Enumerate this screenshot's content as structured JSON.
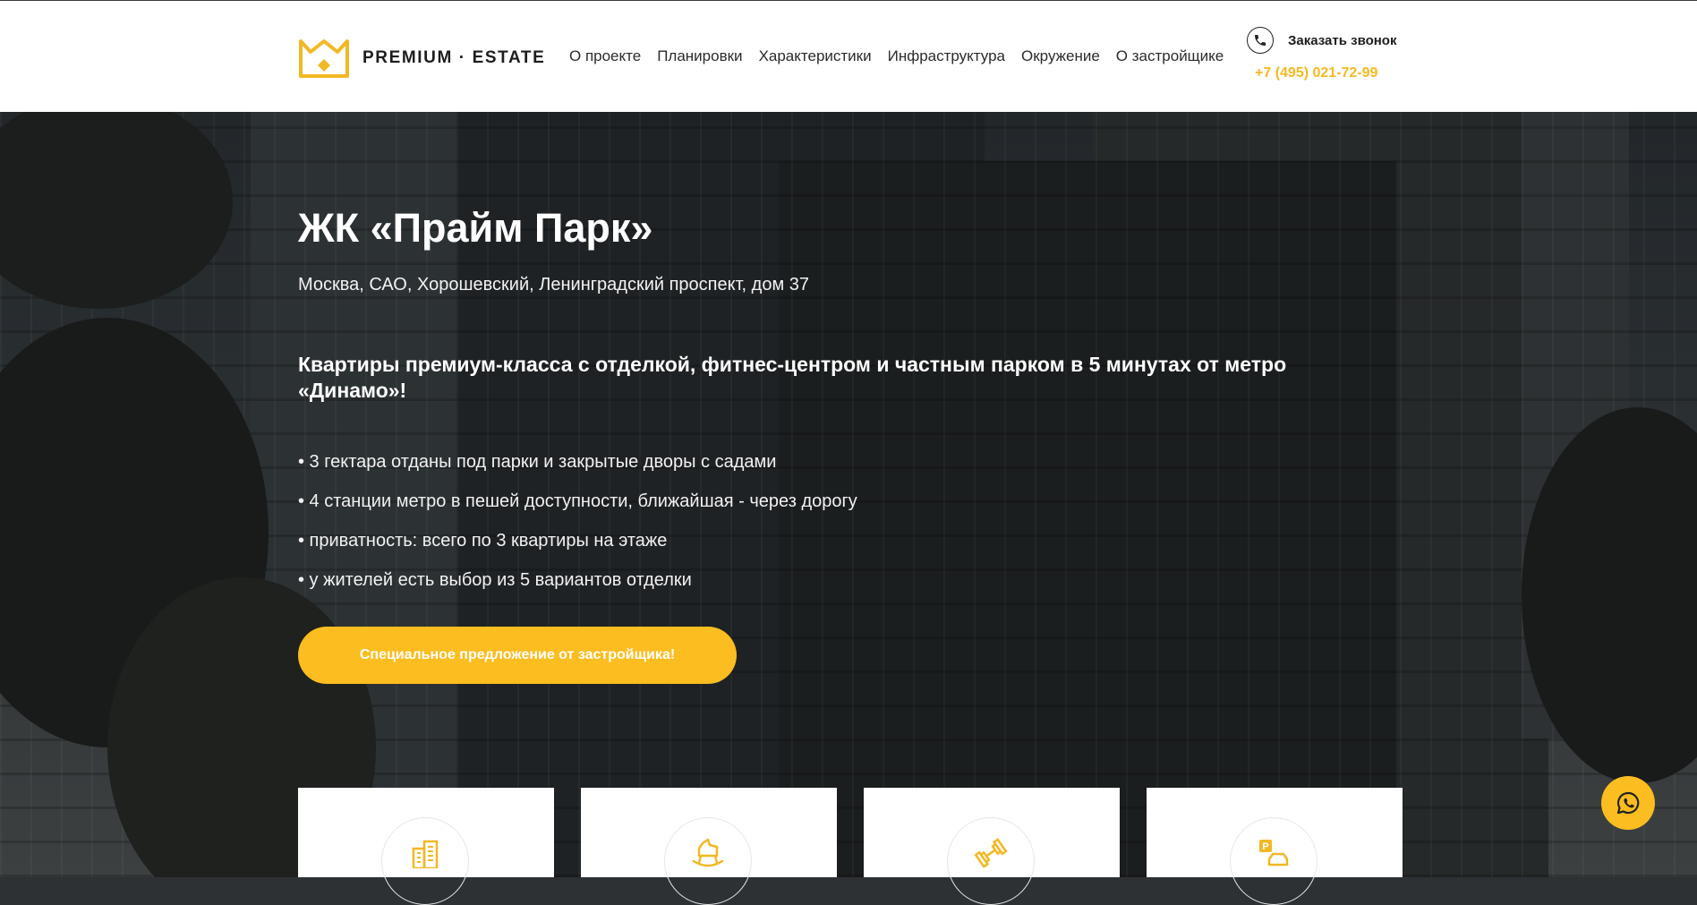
{
  "header": {
    "logo_text": "PREMIUM · ESTATE",
    "nav": [
      "О проекте",
      "Планировки",
      "Характеристики",
      "Инфраструктура",
      "Окружение",
      "О застройщике"
    ],
    "callback_label": "Заказать звонок",
    "phone": "+7 (495) 021-72-99"
  },
  "hero": {
    "title": "ЖК «Прайм Парк»",
    "address": "Москва, САО, Хорошевский, Ленинградский проспект, дом 37",
    "tagline": "Квартиры премиум-класса с отделкой, фитнес-центром и частным парком в 5 минутах от метро «Динамо»!",
    "features": [
      "• 3 гектара отданы под парки и закрытые дворы с садами",
      "• 4 станции метро в пешей доступности, ближайшая - через дорогу",
      "• приватность: всего по 3 квартиры на этаже",
      "• у жителей есть выбор из 5 вариантов отделки"
    ],
    "cta_label": "Специальное предложение от застройщика!"
  },
  "cards": [
    {
      "icon": "buildings-icon"
    },
    {
      "icon": "rocking-horse-icon"
    },
    {
      "icon": "dumbbell-icon"
    },
    {
      "icon": "parking-icon"
    }
  ],
  "colors": {
    "accent": "#fbbd1f",
    "phone": "#f5b921",
    "header_bg": "#ffffff"
  },
  "floating": {
    "icon": "whatsapp-icon"
  }
}
